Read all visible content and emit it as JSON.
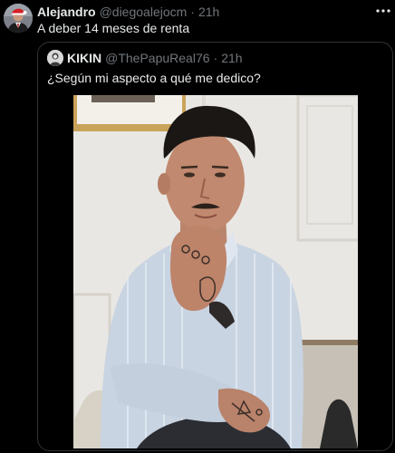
{
  "tweet": {
    "author_name": "Alejandro",
    "author_handle": "@diegoalejocm",
    "separator": "·",
    "time": "21h",
    "text": "A deber 14 meses de renta",
    "more_icon": "more-horizontal-icon"
  },
  "quoted_tweet": {
    "author_name": "KIKIN",
    "author_handle": "@ThePapuReal76",
    "separator": "·",
    "time": "21h",
    "text": "¿Según mi aspecto a qué me dedico?",
    "media": "photo of a tattooed man in a striped shirt posing with hand on chin"
  },
  "colors": {
    "background": "#000000",
    "text_primary": "#e7e9ea",
    "text_secondary": "#71767b",
    "border": "#2f3336"
  }
}
